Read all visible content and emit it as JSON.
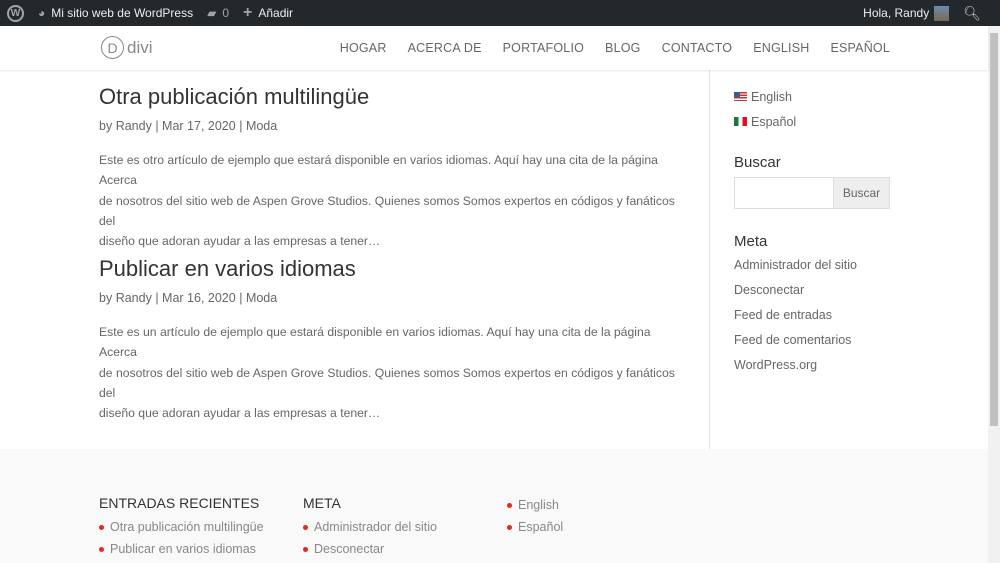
{
  "adminbar": {
    "site": "Mi sitio web de WordPress",
    "comments": "0",
    "add": "Añadir",
    "greeting": "Hola, Randy"
  },
  "header": {
    "logo": "divi",
    "logo_letter": "D",
    "nav": [
      "HOGAR",
      "ACERCA DE",
      "PORTAFOLIO",
      "BLOG",
      "CONTACTO",
      "ENGLISH",
      "ESPAÑOL"
    ]
  },
  "posts": [
    {
      "title": "Otra publicación multilingüe",
      "author": "Randy",
      "date": "Mar 17, 2020",
      "category": "Moda",
      "excerpt": [
        "Este es otro artículo de ejemplo que estará disponible en varios idiomas. Aquí hay una cita de la página Acerca",
        "de nosotros del sitio web de Aspen Grove Studios. Quienes somos Somos expertos en códigos y fanáticos del",
        "diseño que adoran ayudar a las empresas a tener…"
      ]
    },
    {
      "title": "Publicar en varios idiomas",
      "author": "Randy",
      "date": "Mar 16, 2020",
      "category": "Moda",
      "excerpt": [
        "Este es un artículo de ejemplo que estará disponible en varios idiomas. Aquí hay una cita de la página Acerca",
        "de nosotros del sitio web de Aspen Grove Studios. Quienes somos Somos expertos en códigos y fanáticos del",
        "diseño que adoran ayudar a las empresas a tener…"
      ]
    }
  ],
  "meta_by": "by",
  "sep": "|",
  "sidebar": {
    "languages": [
      "English",
      "Español"
    ],
    "search_title": "Buscar",
    "search_button": "Buscar",
    "meta_title": "Meta",
    "meta_links": [
      "Administrador del sitio",
      "Desconectar",
      "Feed de entradas",
      "Feed de comentarios",
      "WordPress.org"
    ]
  },
  "footer": {
    "recent_title": "ENTRADAS RECIENTES",
    "recent": [
      "Otra publicación multilingüe",
      "Publicar en varios idiomas"
    ],
    "meta_title": "META",
    "meta": [
      "Administrador del sitio",
      "Desconectar"
    ],
    "languages": [
      "English",
      "Español"
    ]
  }
}
